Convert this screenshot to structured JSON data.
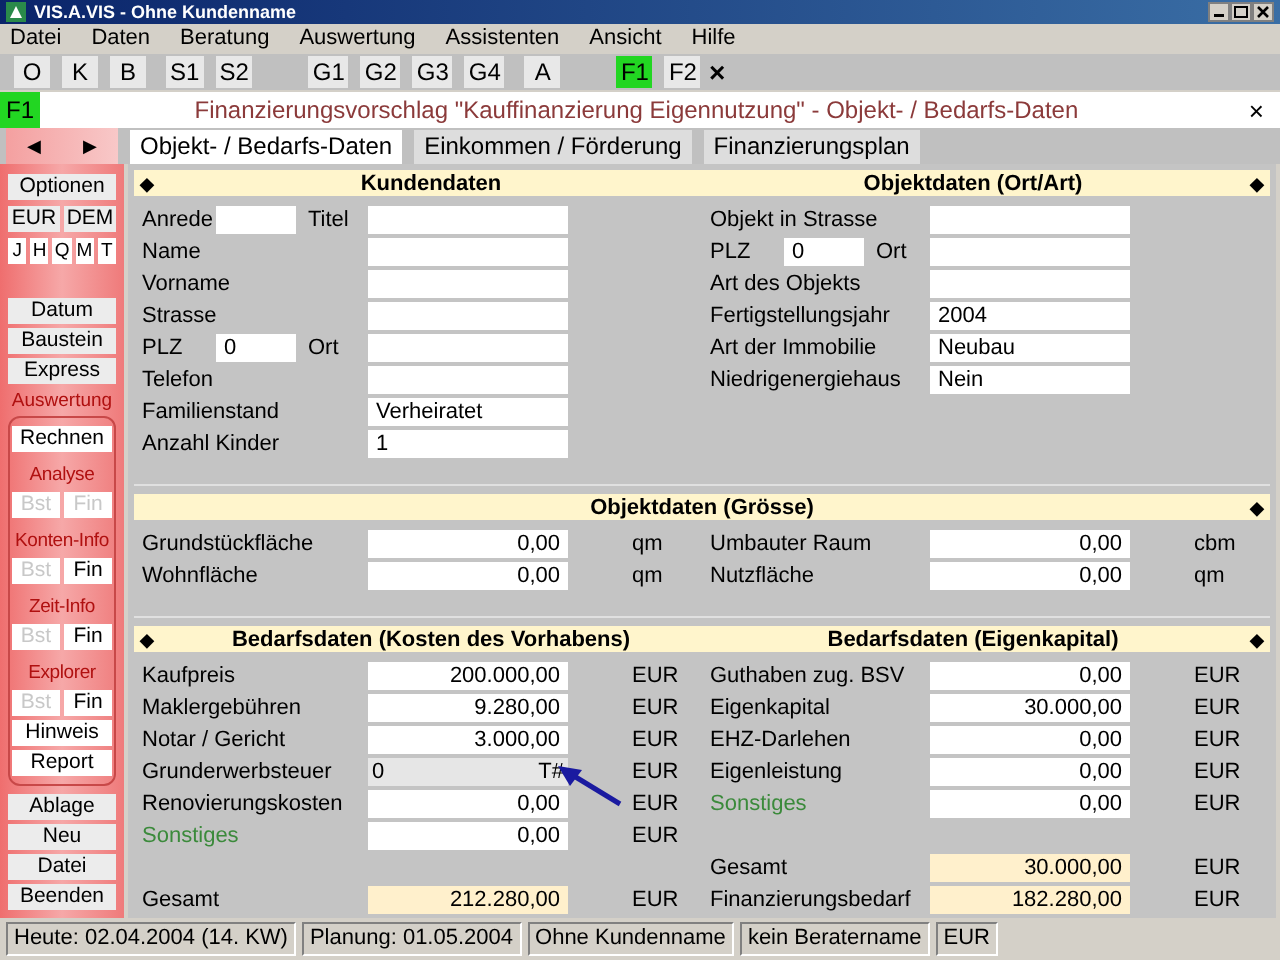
{
  "window": {
    "title": "VIS.A.VIS - Ohne Kundenname"
  },
  "menu": [
    "Datei",
    "Daten",
    "Beratung",
    "Auswertung",
    "Assistenten",
    "Ansicht",
    "Hilfe"
  ],
  "toolbar": {
    "groups": [
      {
        "buttons": [
          {
            "label": "O",
            "selected": false
          },
          {
            "label": "K",
            "selected": false
          },
          {
            "label": "B",
            "selected": false
          }
        ]
      },
      {
        "buttons": [
          {
            "label": "S1",
            "selected": false
          },
          {
            "label": "S2",
            "selected": false
          }
        ]
      },
      {
        "buttons": [
          {
            "label": "G1",
            "selected": false
          },
          {
            "label": "G2",
            "selected": false
          },
          {
            "label": "G3",
            "selected": false
          },
          {
            "label": "G4",
            "selected": false
          }
        ]
      },
      {
        "buttons": [
          {
            "label": "A",
            "selected": false
          }
        ]
      },
      {
        "buttons": [
          {
            "label": "F1",
            "selected": true
          },
          {
            "label": "F2",
            "selected": false
          }
        ]
      }
    ],
    "close": "×"
  },
  "headline": {
    "badge": "F1",
    "title": "Finanzierungsvorschlag \"Kauffinanzierung Eigennutzung\" - Objekt- / Bedarfs-Daten",
    "close": "×"
  },
  "nav": {
    "prev": "◀",
    "next": "▶"
  },
  "tabs": [
    {
      "label": "Objekt- / Bedarfs-Daten",
      "selected": true
    },
    {
      "label": "Einkommen / Förderung",
      "selected": false
    },
    {
      "label": "Finanzierungsplan",
      "selected": false
    }
  ],
  "sidebar": {
    "blocks": [
      {
        "items": [
          {
            "kind": "button",
            "label": "Optionen"
          },
          {
            "kind": "row",
            "buttons": [
              {
                "label": "EUR",
                "disabled": false
              },
              {
                "label": "DEM",
                "disabled": false
              }
            ]
          },
          {
            "kind": "row",
            "buttons": [
              {
                "label": "J",
                "disabled": false
              },
              {
                "label": "H",
                "disabled": false
              },
              {
                "label": "Q",
                "disabled": false
              },
              {
                "label": "M",
                "disabled": false
              },
              {
                "label": "T",
                "disabled": false
              }
            ]
          }
        ]
      },
      {
        "items": [
          {
            "kind": "button",
            "label": "Datum"
          },
          {
            "kind": "button",
            "label": "Baustein"
          },
          {
            "kind": "button",
            "label": "Express"
          }
        ]
      },
      {
        "title": "Auswertung",
        "items": [
          {
            "kind": "button",
            "label": "Rechnen"
          },
          {
            "kind": "label",
            "label": "Analyse"
          },
          {
            "kind": "row",
            "buttons": [
              {
                "label": "Bst",
                "disabled": true
              },
              {
                "label": "Fin",
                "disabled": true
              }
            ]
          },
          {
            "kind": "label",
            "label": "Konten-Info"
          },
          {
            "kind": "row",
            "buttons": [
              {
                "label": "Bst",
                "disabled": true
              },
              {
                "label": "Fin",
                "disabled": false
              }
            ]
          },
          {
            "kind": "label",
            "label": "Zeit-Info"
          },
          {
            "kind": "row",
            "buttons": [
              {
                "label": "Bst",
                "disabled": true
              },
              {
                "label": "Fin",
                "disabled": false
              }
            ]
          },
          {
            "kind": "label",
            "label": "Explorer"
          },
          {
            "kind": "row",
            "buttons": [
              {
                "label": "Bst",
                "disabled": true
              },
              {
                "label": "Fin",
                "disabled": false
              }
            ]
          },
          {
            "kind": "button",
            "label": "Hinweis"
          },
          {
            "kind": "button",
            "label": "Report"
          }
        ]
      },
      {
        "items": [
          {
            "kind": "button",
            "label": "Ablage"
          },
          {
            "kind": "button",
            "label": "Neu"
          },
          {
            "kind": "button",
            "label": "Datei"
          },
          {
            "kind": "button",
            "label": "Beenden"
          }
        ]
      }
    ]
  },
  "sections": [
    {
      "header": {
        "left_marker": "◆",
        "titles": [
          "Kundendaten",
          "Objektdaten (Ort/Art)"
        ],
        "right_marker": "◆"
      },
      "columns": [
        [
          {
            "kind": "pair",
            "label": "Anrede",
            "small": {
              "kind": "text"
            },
            "label2": "Titel",
            "field": {
              "kind": "text"
            }
          },
          {
            "kind": "field",
            "label": "Name",
            "field": {
              "kind": "text"
            }
          },
          {
            "kind": "field",
            "label": "Vorname",
            "field": {
              "kind": "text"
            }
          },
          {
            "kind": "field",
            "label": "Strasse",
            "field": {
              "kind": "text"
            }
          },
          {
            "kind": "pair",
            "label": "PLZ",
            "small": {
              "kind": "text",
              "value": "0"
            },
            "label2": "Ort",
            "field": {
              "kind": "text"
            }
          },
          {
            "kind": "field",
            "label": "Telefon",
            "field": {
              "kind": "text"
            }
          },
          {
            "kind": "field",
            "label": "Familienstand",
            "field": {
              "kind": "text",
              "value": "Verheiratet"
            }
          },
          {
            "kind": "field",
            "label": "Anzahl Kinder",
            "field": {
              "kind": "text",
              "value": "1"
            }
          }
        ],
        [
          {
            "kind": "field",
            "label": "Objekt in Strasse",
            "field": {
              "kind": "text"
            }
          },
          {
            "kind": "pair",
            "label": "PLZ",
            "small": {
              "kind": "text",
              "value": "0"
            },
            "label2": "Ort",
            "field": {
              "kind": "text"
            }
          },
          {
            "kind": "field",
            "label": "Art des Objekts",
            "field": {
              "kind": "text"
            }
          },
          {
            "kind": "field",
            "label": "Fertigstellungsjahr",
            "field": {
              "kind": "text",
              "value": "2004"
            }
          },
          {
            "kind": "field",
            "label": "Art der Immobilie",
            "field": {
              "kind": "text",
              "value": "Neubau"
            }
          },
          {
            "kind": "field",
            "label": "Niedrigenergiehaus",
            "field": {
              "kind": "text",
              "value": "Nein"
            }
          }
        ]
      ]
    },
    {
      "header": {
        "titles": [
          "Objektdaten (Grösse)"
        ],
        "right_marker": "◆"
      },
      "columns": [
        [
          {
            "kind": "field",
            "label": "Grundstückfläche",
            "field": {
              "kind": "amount",
              "value": "0,00"
            },
            "unit": "qm"
          },
          {
            "kind": "field",
            "label": "Wohnfläche",
            "field": {
              "kind": "amount",
              "value": "0,00"
            },
            "unit": "qm"
          }
        ],
        [
          {
            "kind": "field",
            "label": "Umbauter Raum",
            "field": {
              "kind": "amount",
              "value": "0,00"
            },
            "unit": "cbm"
          },
          {
            "kind": "field",
            "label": "Nutzfläche",
            "field": {
              "kind": "amount",
              "value": "0,00"
            },
            "unit": "qm"
          }
        ]
      ]
    },
    {
      "header": {
        "left_marker": "◆",
        "titles": [
          "Bedarfsdaten (Kosten des Vorhabens)",
          "Bedarfsdaten (Eigenkapital)"
        ],
        "right_marker": "◆"
      },
      "columns": [
        {
          "rows": [
            {
              "kind": "field",
              "label": "Kaufpreis",
              "field": {
                "kind": "amount",
                "value": "200.000,00"
              },
              "unit": "EUR"
            },
            {
              "kind": "field",
              "label": "Maklergebühren",
              "field": {
                "kind": "amount",
                "value": "9.280,00"
              },
              "unit": "EUR"
            },
            {
              "kind": "field",
              "label": "Notar / Gericht",
              "field": {
                "kind": "amount",
                "value": "3.000,00"
              },
              "unit": "EUR"
            },
            {
              "kind": "field",
              "label": "Grunderwerbsteuer",
              "field": {
                "kind": "readonly",
                "value": "0",
                "suffix": "T#"
              },
              "unit": "EUR"
            },
            {
              "kind": "field",
              "label": "Renovierungskosten",
              "field": {
                "kind": "amount",
                "value": "0,00"
              },
              "unit": "EUR"
            },
            {
              "kind": "field",
              "label": "Sonstiges",
              "color": "#3b8a3b",
              "field": {
                "kind": "amount",
                "value": "0,00"
              },
              "unit": "EUR"
            }
          ],
          "totals": [
            {
              "kind": "field",
              "label": "Gesamt",
              "field": {
                "kind": "total",
                "value": "212.280,00"
              },
              "unit": "EUR"
            }
          ]
        },
        {
          "rows": [
            {
              "kind": "field",
              "label": "Guthaben zug. BSV",
              "field": {
                "kind": "amount",
                "value": "0,00"
              },
              "unit": "EUR"
            },
            {
              "kind": "field",
              "label": "Eigenkapital",
              "field": {
                "kind": "amount",
                "value": "30.000,00"
              },
              "unit": "EUR"
            },
            {
              "kind": "field",
              "label": "EHZ-Darlehen",
              "field": {
                "kind": "amount",
                "value": "0,00"
              },
              "unit": "EUR"
            },
            {
              "kind": "field",
              "label": "Eigenleistung",
              "field": {
                "kind": "amount",
                "value": "0,00"
              },
              "unit": "EUR"
            },
            {
              "kind": "field",
              "label": "Sonstiges",
              "color": "#3b8a3b",
              "field": {
                "kind": "amount",
                "value": "0,00"
              },
              "unit": "EUR"
            }
          ],
          "totals": [
            {
              "kind": "field",
              "label": "Gesamt",
              "field": {
                "kind": "total",
                "value": "30.000,00"
              },
              "unit": "EUR"
            },
            {
              "kind": "field",
              "label": "Finanzierungsbedarf",
              "field": {
                "kind": "total",
                "value": "182.280,00"
              },
              "unit": "EUR"
            }
          ]
        }
      ]
    }
  ],
  "status_bar": [
    "Heute: 02.04.2004 (14. KW)",
    "Planung: 01.05.2004",
    "Ohne Kundenname",
    "kein Beratername",
    "EUR"
  ]
}
